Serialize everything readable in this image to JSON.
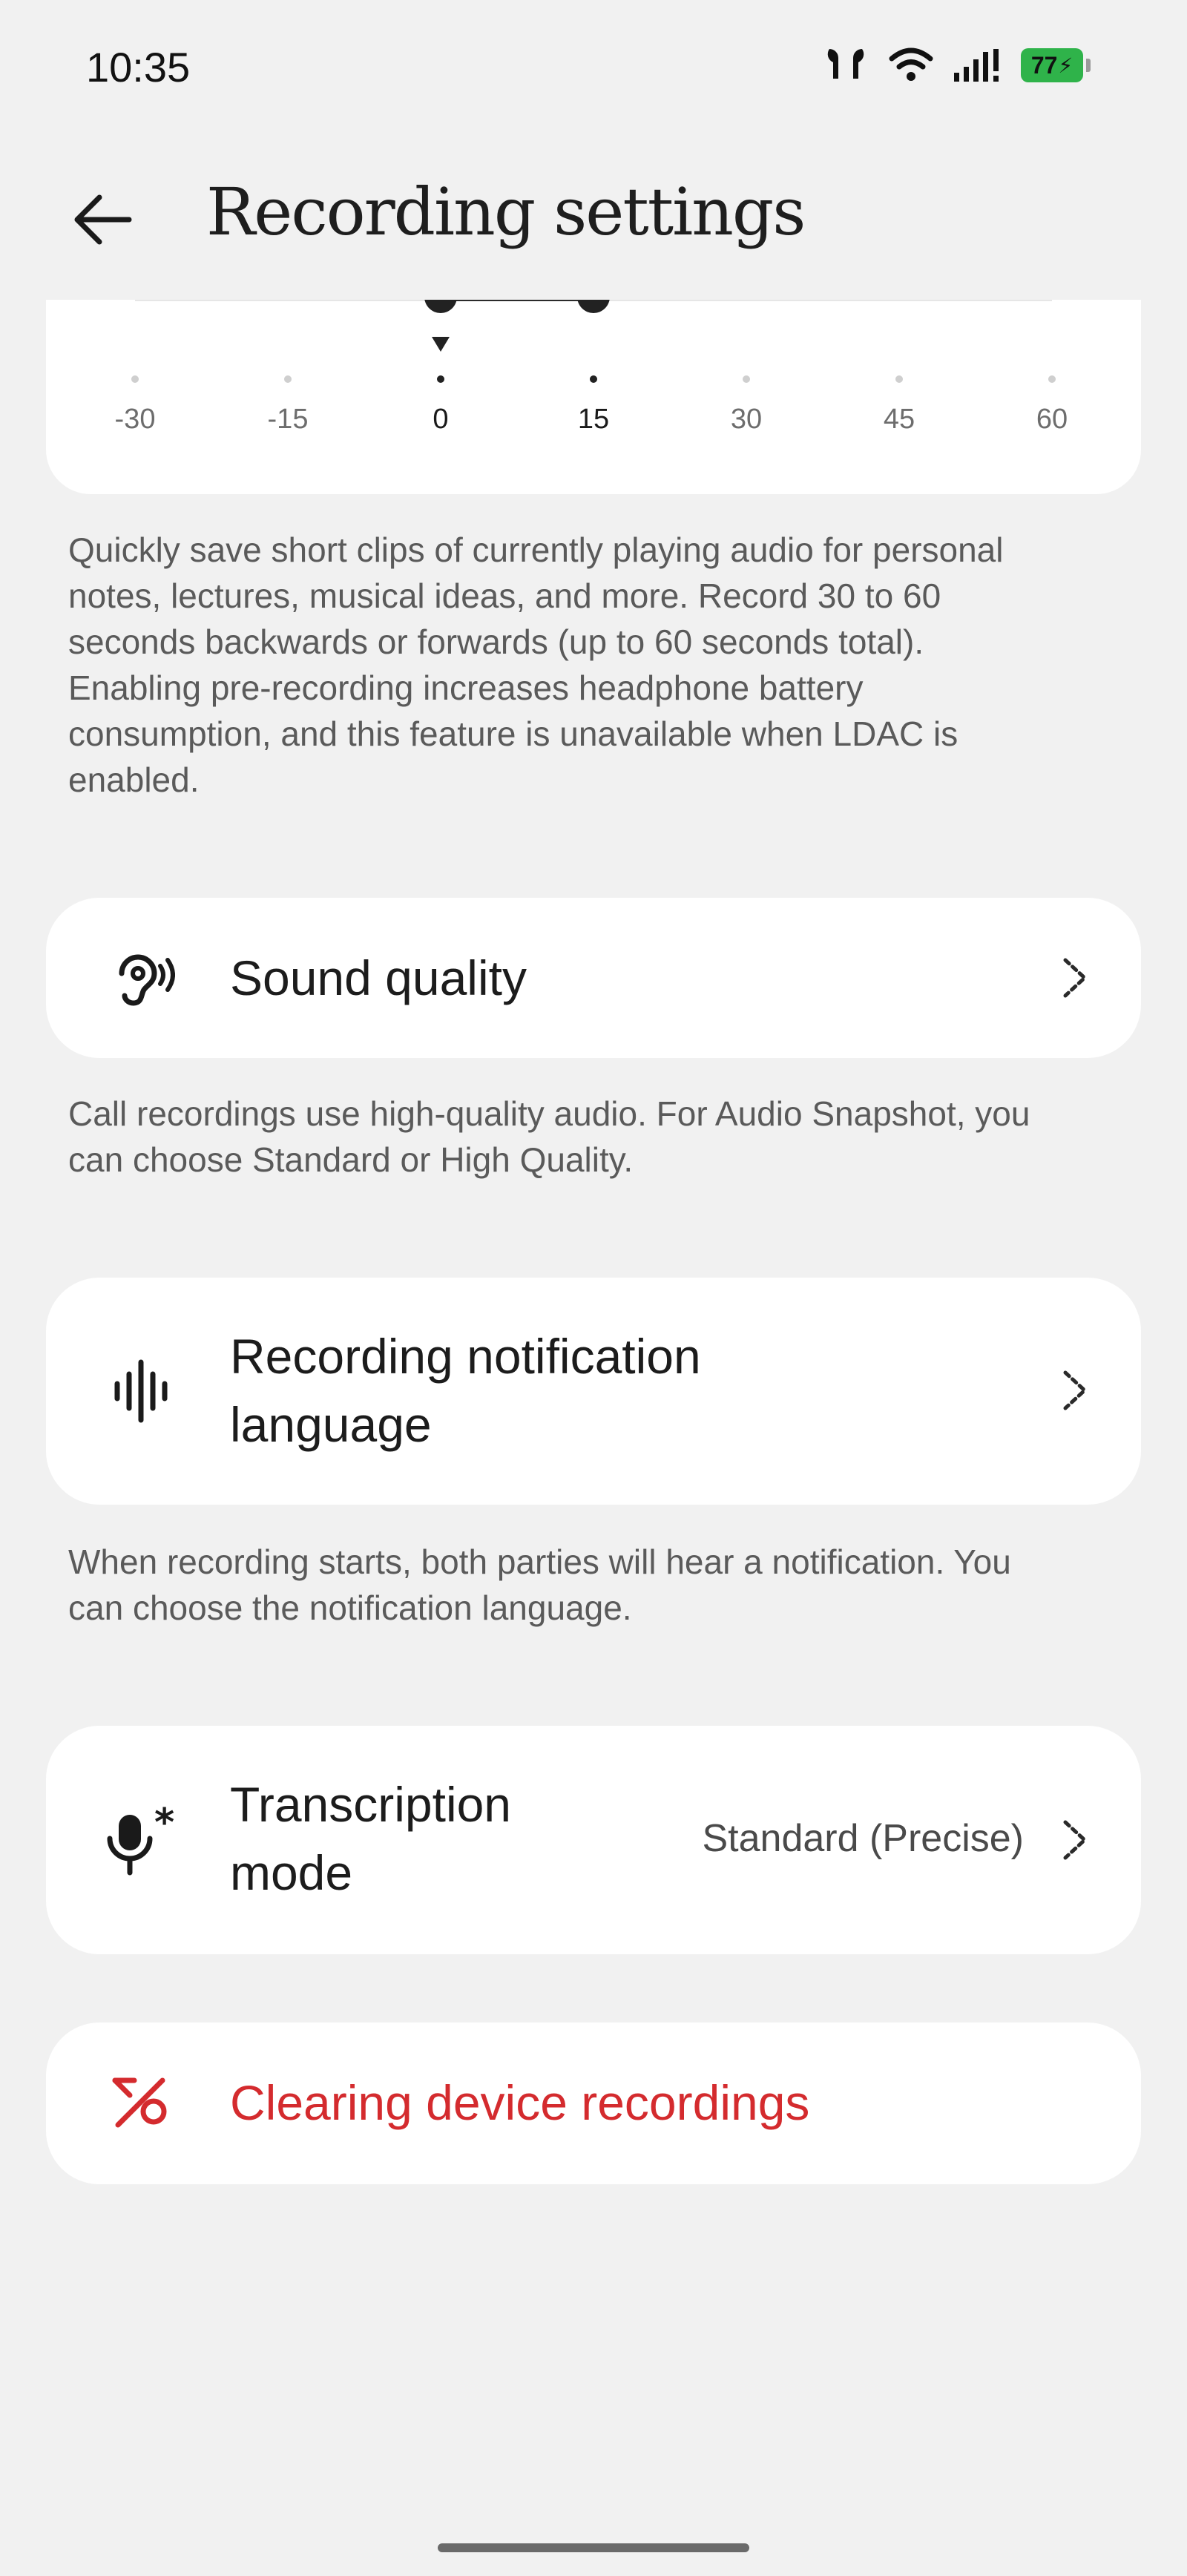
{
  "status_bar": {
    "time": "10:35",
    "battery": "77"
  },
  "header": {
    "title": "Recording settings"
  },
  "slider": {
    "ticks": [
      "-30",
      "-15",
      "0",
      "15",
      "30",
      "45",
      "60"
    ],
    "selected_range": [
      "0",
      "15"
    ]
  },
  "snapshot_description": [
    "Quickly save short clips of currently playing audio for personal",
    "notes, lectures, musical ideas, and more. Record 30 to 60",
    "seconds backwards or forwards (up to 60 seconds total).",
    "Enabling pre-recording increases headphone battery",
    "consumption, and this feature is unavailable when LDAC is",
    "enabled."
  ],
  "sound_quality": {
    "label": "Sound quality",
    "description": [
      "Call recordings use high-quality audio. For Audio Snapshot, you",
      "can choose Standard or High Quality."
    ]
  },
  "notification_language": {
    "label": [
      "Recording notification",
      "language"
    ],
    "description": [
      "When recording starts, both parties will hear a notification. You",
      "can choose the notification language."
    ]
  },
  "transcription_mode": {
    "label": [
      "Transcription",
      "mode"
    ],
    "value": "Standard (Precise)"
  },
  "clear_recordings": {
    "label": "Clearing device recordings",
    "color": "#d42b2e"
  },
  "icons": {
    "back": "back-arrow-icon",
    "sound_quality": "ear-sound-icon",
    "notification_language": "waveform-icon",
    "transcription_mode": "microphone-asterisk-icon",
    "clear_recordings": "clear-percent-icon",
    "chevron": "chevron-right-icon"
  }
}
